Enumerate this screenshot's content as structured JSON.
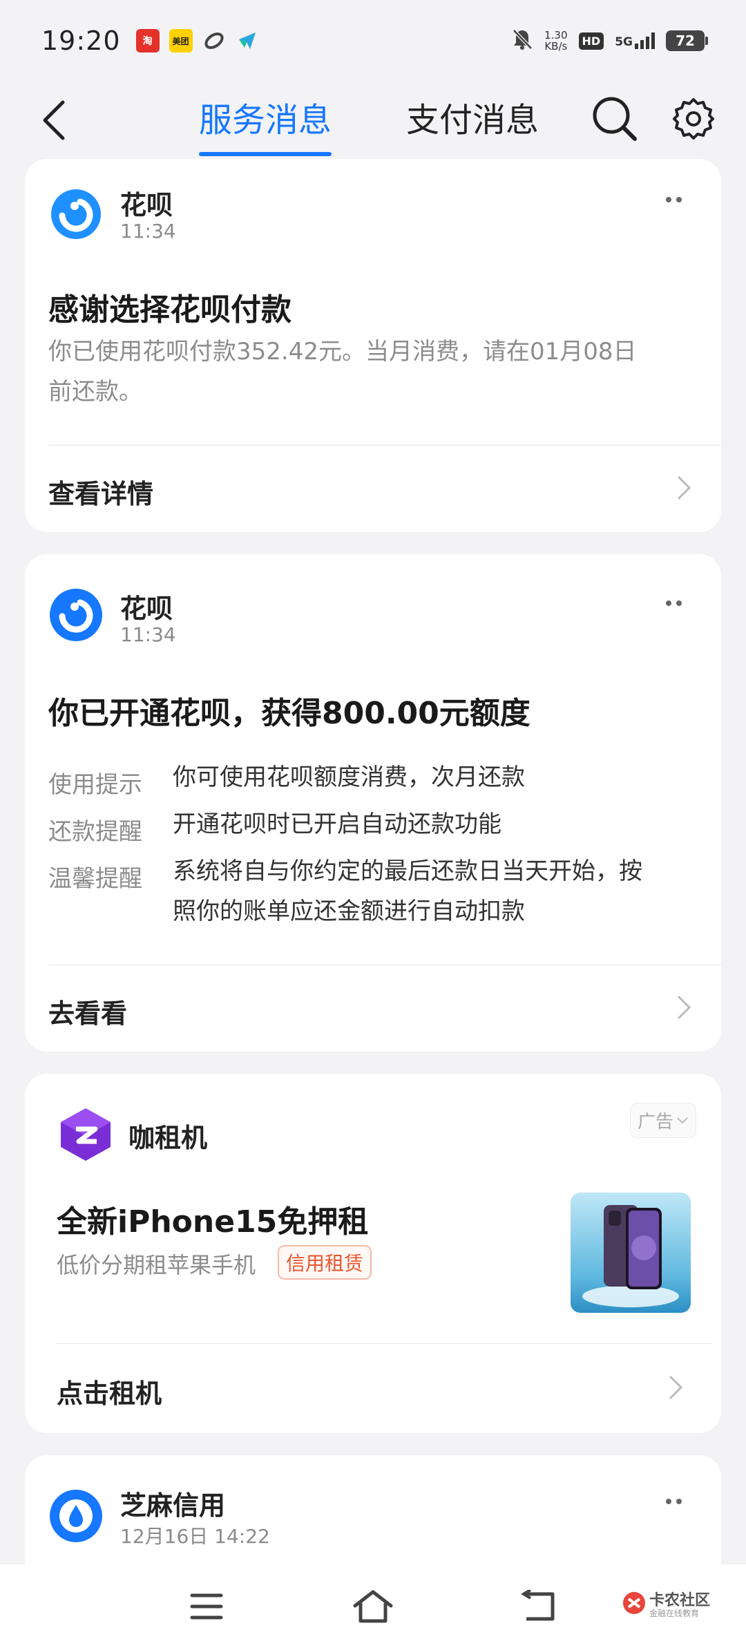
{
  "status": {
    "time": "19:20",
    "net_speed": "1.30",
    "net_unit": "KB/s",
    "hd": "HD",
    "network": "5G",
    "battery": "72",
    "notif_icons": [
      "taobao-icon",
      "meituan-icon",
      "link-app-icon",
      "feishu-icon"
    ]
  },
  "nav": {
    "tabs": [
      {
        "label": "服务消息",
        "active": true
      },
      {
        "label": "支付消息",
        "active": false
      }
    ]
  },
  "cards": [
    {
      "sender": "花呗",
      "time": "11:34",
      "title": "感谢选择花呗付款",
      "body_line1": "你已使用花呗付款352.42元。当月消费，请在01月08日",
      "body_line2": "前还款。",
      "action": "查看详情"
    },
    {
      "sender": "花呗",
      "time": "11:34",
      "title": "你已开通花呗，获得800.00元额度",
      "rows": [
        {
          "label": "使用提示",
          "value": "你可使用花呗额度消费，次月还款"
        },
        {
          "label": "还款提醒",
          "value": "开通花呗时已开启自动还款功能"
        },
        {
          "label": "温馨提醒",
          "value_line1": "系统将自与你约定的最后还款日当天开始，按",
          "value_line2": "照你的账单应还金额进行自动扣款"
        }
      ],
      "action": "去看看"
    },
    {
      "sender": "咖租机",
      "ad_label": "广告",
      "title": "全新iPhone15免押租",
      "subtitle": "低价分期租苹果手机",
      "badge": "信用租赁",
      "action": "点击租机"
    },
    {
      "sender": "芝麻信用",
      "time": "12月16日 14:22"
    }
  ],
  "watermark": {
    "title": "卡农社区",
    "subtitle": "金融在线教育"
  },
  "colors": {
    "accent": "#1677ff",
    "background": "#f3f3f5",
    "badge": "#e8552f"
  }
}
